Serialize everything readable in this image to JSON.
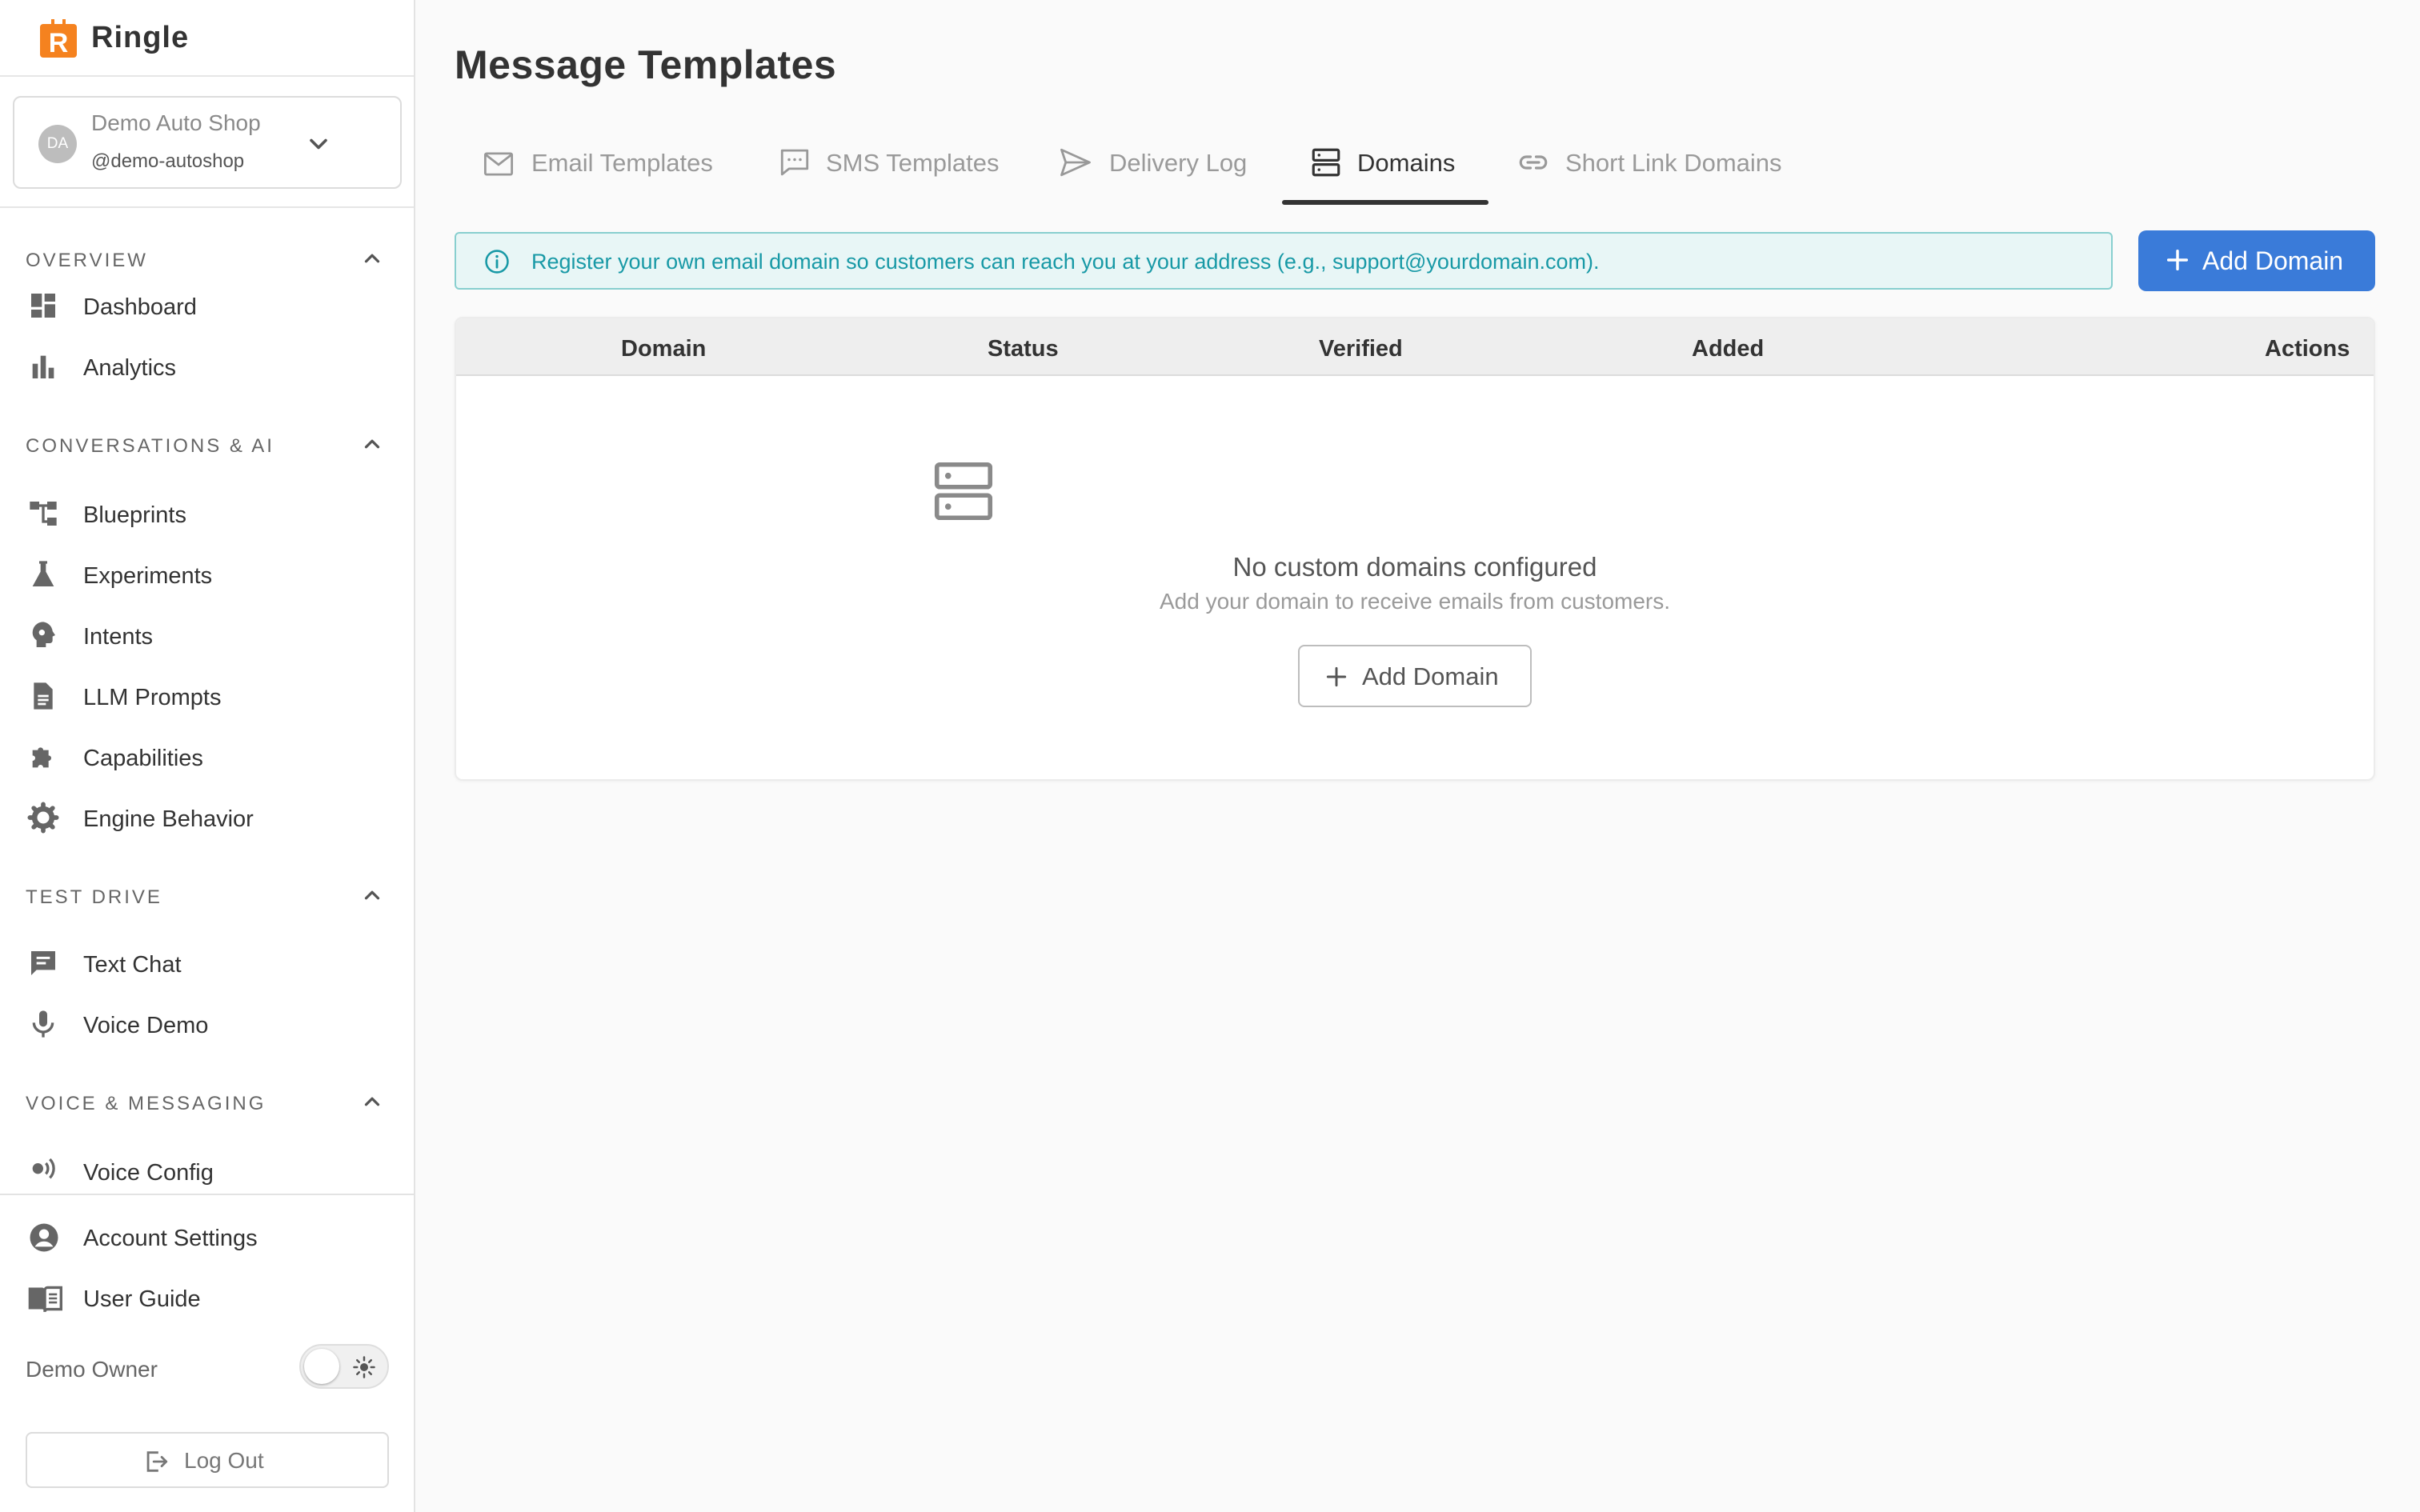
{
  "app": {
    "name": "Ringle",
    "accent": "#3a7bd9",
    "logo_color": "#f5821f"
  },
  "account": {
    "initials": "DA",
    "name": "Demo Auto Shop",
    "handle": "@demo-autoshop"
  },
  "sidebar": {
    "sections": [
      {
        "title": "OVERVIEW",
        "items": [
          {
            "label": "Dashboard",
            "icon": "dashboard-icon"
          },
          {
            "label": "Analytics",
            "icon": "bar-chart-icon"
          }
        ]
      },
      {
        "title": "CONVERSATIONS & AI",
        "items": [
          {
            "label": "Blueprints",
            "icon": "flowchart-icon"
          },
          {
            "label": "Experiments",
            "icon": "flask-icon"
          },
          {
            "label": "Intents",
            "icon": "brain-icon"
          },
          {
            "label": "LLM Prompts",
            "icon": "document-icon"
          },
          {
            "label": "Capabilities",
            "icon": "puzzle-icon"
          },
          {
            "label": "Engine Behavior",
            "icon": "gear-icon"
          }
        ]
      },
      {
        "title": "TEST DRIVE",
        "items": [
          {
            "label": "Text Chat",
            "icon": "chat-icon"
          },
          {
            "label": "Voice Demo",
            "icon": "microphone-icon"
          }
        ]
      },
      {
        "title": "VOICE & MESSAGING",
        "items": [
          {
            "label": "Voice Config",
            "icon": "voice-config-icon"
          }
        ]
      }
    ],
    "bottom": {
      "account_settings": "Account Settings",
      "user_guide": "User Guide",
      "demo_owner": "Demo Owner",
      "logout": "Log Out"
    }
  },
  "main": {
    "title": "Message Templates",
    "tabs": [
      {
        "label": "Email Templates",
        "icon": "mail-icon",
        "active": false
      },
      {
        "label": "SMS Templates",
        "icon": "sms-icon",
        "active": false
      },
      {
        "label": "Delivery Log",
        "icon": "send-icon",
        "active": false
      },
      {
        "label": "Domains",
        "icon": "server-icon",
        "active": true
      },
      {
        "label": "Short Link Domains",
        "icon": "link-icon",
        "active": false
      }
    ],
    "info_banner": "Register your own email domain so customers can reach you at your address (e.g., support@yourdomain.com).",
    "add_domain_label": "Add Domain",
    "table": {
      "columns": [
        "Domain",
        "Status",
        "Verified",
        "Added",
        "Actions"
      ]
    },
    "empty_state": {
      "title": "No custom domains configured",
      "subtitle": "Add your domain to receive emails from customers.",
      "button": "Add Domain"
    }
  }
}
